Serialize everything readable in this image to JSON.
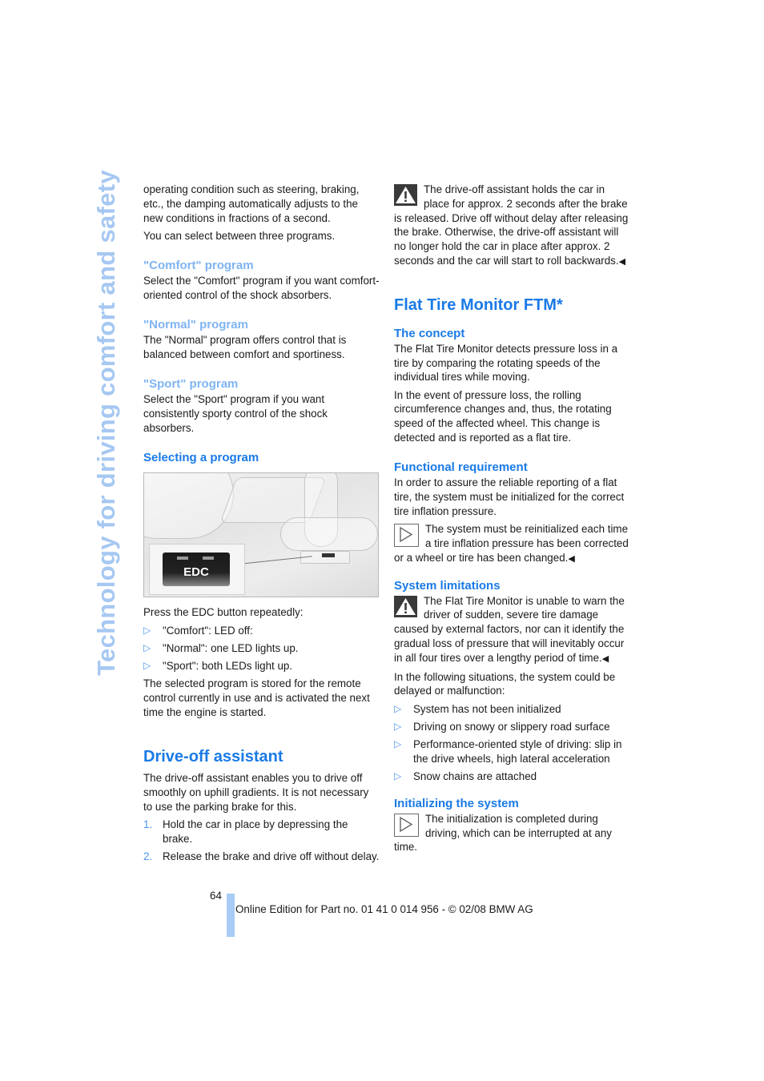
{
  "side_title": "Technology for driving comfort and safety",
  "left_column": {
    "intro_paragraphs": [
      "operating condition such as steering, braking, etc., the damping automatically adjusts to the new conditions in fractions of a second.",
      "You can select between three programs."
    ],
    "programs": [
      {
        "heading": "\"Comfort\" program",
        "text": "Select the \"Comfort\" program if you want comfort-oriented control of the shock absorbers."
      },
      {
        "heading": "\"Normal\" program",
        "text": "The \"Normal\" program offers control that is balanced between comfort and sportiness."
      },
      {
        "heading": "\"Sport\" program",
        "text": "Select the \"Sport\" program if you want consistently sporty control of the shock absorbers."
      }
    ],
    "selecting_heading": "Selecting a program",
    "figure": {
      "button_label": "EDC"
    },
    "press_text": "Press the EDC button repeatedly:",
    "bullet_symbol": "▷",
    "press_items": [
      "\"Comfort\": LED off:",
      "\"Normal\": one LED lights up.",
      "\"Sport\": both LEDs light up."
    ],
    "stored_text": "The selected program is stored for the remote control currently in use and is activated the next time the engine is started.",
    "drive_off_heading": "Drive-off assistant",
    "drive_off_text": "The drive-off assistant enables you to drive off smoothly on uphill gradients. It is not necessary to use the parking brake for this.",
    "steps": [
      {
        "num": "1.",
        "text": "Hold the car in place by depressing the brake."
      },
      {
        "num": "2.",
        "text": "Release the brake and drive off without delay."
      }
    ]
  },
  "right_column": {
    "drive_off_warning": "The drive-off assistant holds the car in place for approx. 2 seconds after the brake is released. Drive off without delay after releasing the brake. Otherwise, the drive-off assistant will no longer hold the car in place after approx. 2 seconds and the car will start to roll backwards.",
    "end_mark": "◀",
    "ftm_heading": "Flat Tire Monitor FTM*",
    "concept_heading": "The concept",
    "concept_paragraphs": [
      "The Flat Tire Monitor detects pressure loss in a tire by comparing the rotating speeds of the individual tires while moving.",
      "In the event of pressure loss, the rolling circumference changes and, thus, the rotating speed of the affected wheel. This change is detected and is reported as a flat tire."
    ],
    "functional_heading": "Functional requirement",
    "functional_text": "In order to assure the reliable reporting of a flat tire, the system must be initialized for the correct tire inflation pressure.",
    "functional_note": "The system must be reinitialized each time a tire inflation pressure has been corrected or a wheel or tire has been changed.",
    "limitations_heading": "System limitations",
    "limitations_warning": "The Flat Tire Monitor is unable to warn the driver of sudden, severe tire damage caused by external factors, nor can it identify the gradual loss of pressure that will inevitably occur in all four tires over a lengthy period of time.",
    "situations_text": "In the following situations, the system could be delayed or malfunction:",
    "situations": [
      "System has not been initialized",
      "Driving on snowy or slippery road surface",
      "Performance-oriented style of driving: slip in the drive wheels, high lateral acceleration",
      "Snow chains are attached"
    ],
    "init_heading": "Initializing the system",
    "init_note": "The initialization is completed during driving, which can be interrupted at any time."
  },
  "footer": {
    "page_number": "64",
    "edition_text": "Online Edition for Part no. 01 41 0 014 956 - © 02/08 BMW AG"
  },
  "colors": {
    "heading_blue": "#1a7ae6",
    "light_heading_blue": "#7fb4f2",
    "side_title": "#a6c8f2",
    "footer_bar": "#a9cbf5"
  }
}
